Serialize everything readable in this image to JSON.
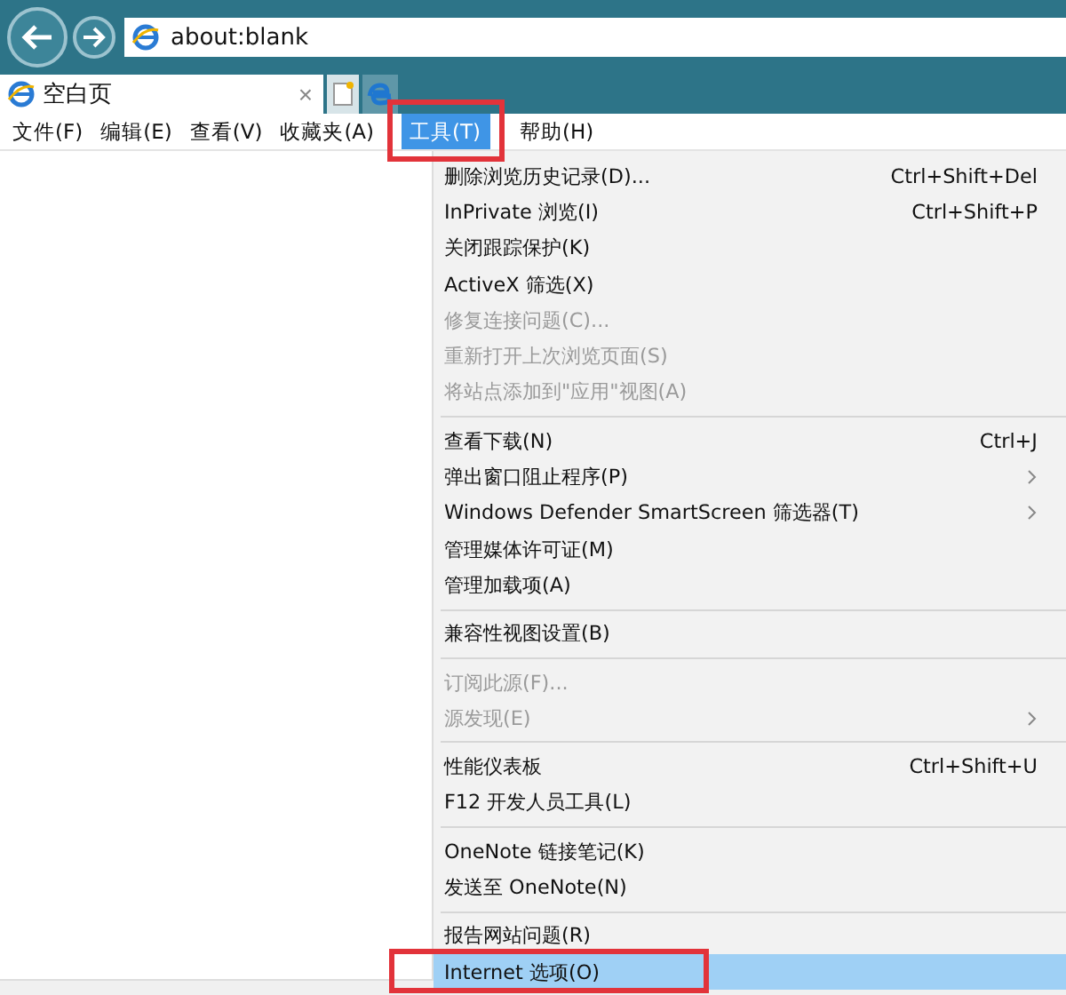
{
  "address_bar": {
    "url": "about:blank"
  },
  "tabs": [
    {
      "title": "空白页",
      "close": "×",
      "selected": true
    }
  ],
  "menu_bar": [
    {
      "label": "文件(F)",
      "selected": false
    },
    {
      "label": "编辑(E)",
      "selected": false
    },
    {
      "label": "查看(V)",
      "selected": false
    },
    {
      "label": "收藏夹(A)",
      "selected": false
    },
    {
      "label": "工具(T)",
      "selected": true
    },
    {
      "label": "帮助(H)",
      "selected": false
    }
  ],
  "tools_menu": {
    "groups": [
      [
        {
          "label": "删除浏览历史记录(D)...",
          "shortcut": "Ctrl+Shift+Del",
          "disabled": false,
          "submenu": false,
          "selected": false
        },
        {
          "label": "InPrivate 浏览(I)",
          "shortcut": "Ctrl+Shift+P",
          "disabled": false,
          "submenu": false,
          "selected": false
        },
        {
          "label": "关闭跟踪保护(K)",
          "disabled": false,
          "submenu": false,
          "selected": false
        },
        {
          "label": "ActiveX 筛选(X)",
          "disabled": false,
          "submenu": false,
          "selected": false
        },
        {
          "label": "修复连接问题(C)...",
          "disabled": true,
          "submenu": false,
          "selected": false
        },
        {
          "label": "重新打开上次浏览页面(S)",
          "disabled": true,
          "submenu": false,
          "selected": false
        },
        {
          "label": "将站点添加到\"应用\"视图(A)",
          "disabled": true,
          "submenu": false,
          "selected": false
        }
      ],
      [
        {
          "label": "查看下载(N)",
          "shortcut": "Ctrl+J",
          "disabled": false,
          "submenu": false,
          "selected": false
        },
        {
          "label": "弹出窗口阻止程序(P)",
          "disabled": false,
          "submenu": true,
          "selected": false
        },
        {
          "label": "Windows Defender SmartScreen 筛选器(T)",
          "disabled": false,
          "submenu": true,
          "selected": false
        },
        {
          "label": "管理媒体许可证(M)",
          "disabled": false,
          "submenu": false,
          "selected": false
        },
        {
          "label": "管理加载项(A)",
          "disabled": false,
          "submenu": false,
          "selected": false
        }
      ],
      [
        {
          "label": "兼容性视图设置(B)",
          "disabled": false,
          "submenu": false,
          "selected": false
        }
      ],
      [
        {
          "label": "订阅此源(F)...",
          "disabled": true,
          "submenu": false,
          "selected": false
        },
        {
          "label": "源发现(E)",
          "disabled": true,
          "submenu": true,
          "selected": false
        }
      ],
      [
        {
          "label": "性能仪表板",
          "shortcut": "Ctrl+Shift+U",
          "disabled": false,
          "submenu": false,
          "selected": false
        },
        {
          "label": "F12 开发人员工具(L)",
          "disabled": false,
          "submenu": false,
          "selected": false
        }
      ],
      [
        {
          "label": "OneNote 链接笔记(K)",
          "disabled": false,
          "submenu": false,
          "selected": false
        },
        {
          "label": "发送至 OneNote(N)",
          "disabled": false,
          "submenu": false,
          "selected": false
        }
      ],
      [
        {
          "label": "报告网站问题(R)",
          "disabled": false,
          "submenu": false,
          "selected": false
        },
        {
          "label": "Internet 选项(O)",
          "disabled": false,
          "submenu": false,
          "selected": true
        }
      ]
    ]
  }
}
